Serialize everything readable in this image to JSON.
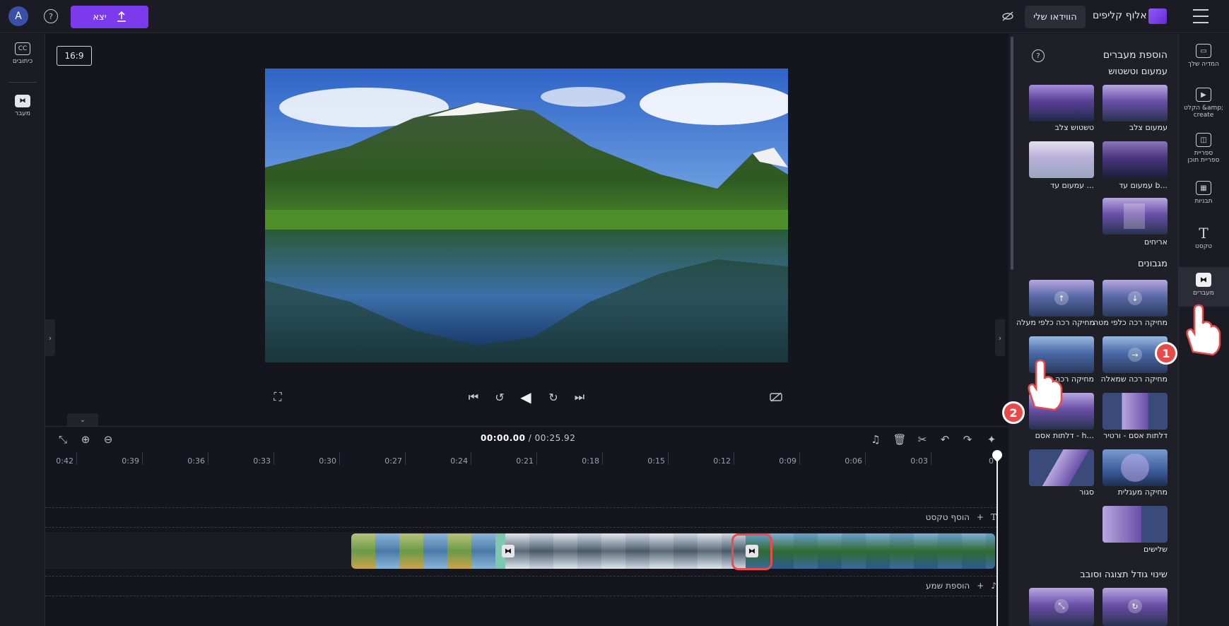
{
  "topbar": {
    "avatar_letter": "A",
    "export_label": "יצא",
    "my_videos_label": "הווידאו שלי",
    "app_title": "אלוף קליפים"
  },
  "left_rail": {
    "captions_label": "כיתובים",
    "transition_label": "מעבר"
  },
  "preview": {
    "aspect_ratio": "16:9"
  },
  "timeline": {
    "current_time": "00:00.00",
    "total_time": "00:25.92",
    "ruler_labels": [
      "0",
      "0:03",
      "0:06",
      "0:09",
      "0:12",
      "0:15",
      "0:18",
      "0:21",
      "0:24",
      "0:27",
      "0:30",
      "0:33",
      "0:36",
      "0:39",
      "0:42"
    ],
    "add_text_label": "הוסף טקסט",
    "add_audio_label": "הוספת שמע"
  },
  "panel": {
    "title": "הוספת מעברים",
    "sections": [
      {
        "title": "עמעום וטשטוש",
        "tiles": [
          {
            "label": "עמעום צלב"
          },
          {
            "label": "טשטוש צלב"
          },
          {
            "label": "עמעום עד b..."
          },
          {
            "label": "עמעום עד ..."
          },
          {
            "label": "אריחים"
          }
        ]
      },
      {
        "title": "מגבונים",
        "tiles": [
          {
            "label": "מחיקה רכה כלפי מטה"
          },
          {
            "label": "מחיקה רכה כלפי מעלה"
          },
          {
            "label": "מחיקה רכה שמאלה"
          },
          {
            "label": "מחיקה רכה י"
          },
          {
            "label": "דלתות אסם - ורטיר"
          },
          {
            "label": "דלתות אסם - h..."
          },
          {
            "label": "מחיקה מעגלית"
          },
          {
            "label": "סגור"
          },
          {
            "label": "שלישים"
          }
        ]
      },
      {
        "title": "שינוי גודל תצוגה וסובב",
        "tiles": []
      }
    ]
  },
  "right_rail": {
    "items": [
      {
        "label": "המדיה שלך"
      },
      {
        "label": "הקלט &amp; create"
      },
      {
        "label": "ספריית ספריית תוכן"
      },
      {
        "label": "תבניות"
      },
      {
        "label": "טקסט"
      },
      {
        "label": "מעברים"
      }
    ]
  },
  "annotations": {
    "step1": "1",
    "step2": "2"
  },
  "colors": {
    "accent": "#7c3aed",
    "highlight": "#ef4a4a",
    "panel_bg": "#1f1f28"
  }
}
